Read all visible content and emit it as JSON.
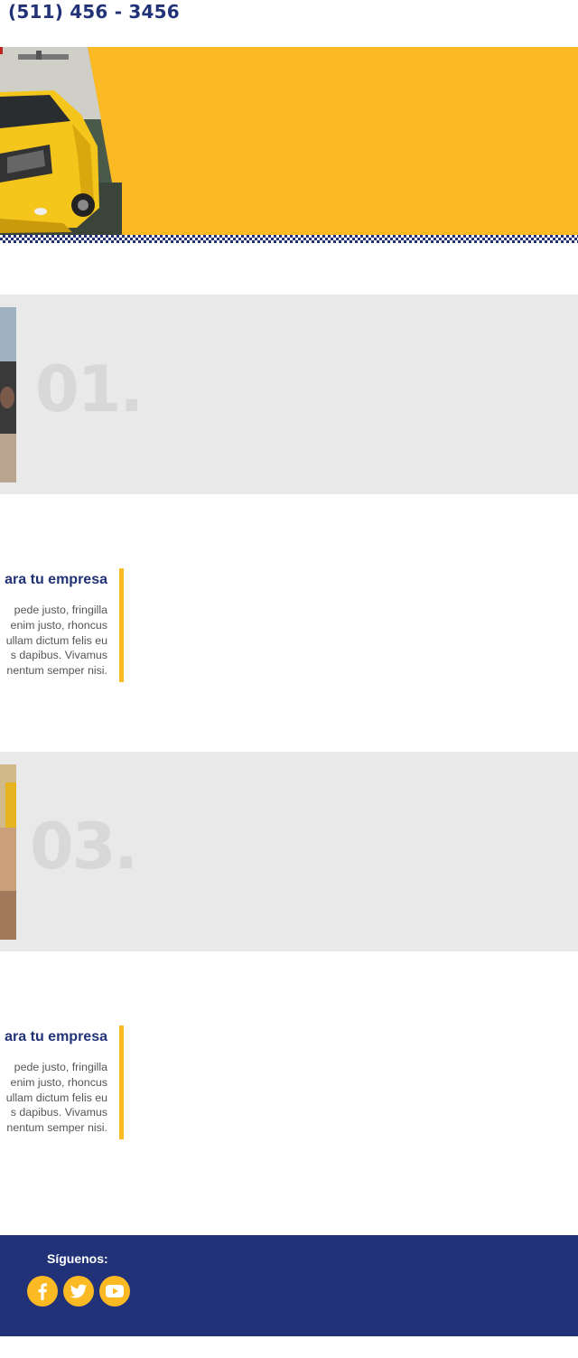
{
  "header": {
    "phone": "(511) 456 - 3456"
  },
  "steps": [
    {
      "number": "01."
    },
    {
      "number": "03."
    }
  ],
  "features": [
    {
      "title": "ara tu empresa",
      "lines": [
        " pede justo, fringilla",
        "enim justo, rhoncus",
        "ullam dictum felis eu",
        "s dapibus. Vivamus",
        "nentum semper nisi."
      ]
    },
    {
      "title": "ara tu empresa",
      "lines": [
        " pede justo, fringilla",
        "enim justo, rhoncus",
        "ullam dictum felis eu",
        "s dapibus. Vivamus",
        "nentum semper nisi."
      ]
    }
  ],
  "footer": {
    "follow_label": "Síguenos:",
    "social_icons": [
      "facebook-icon",
      "twitter-icon",
      "youtube-icon"
    ]
  },
  "colors": {
    "brand_yellow": "#FBB923",
    "brand_navy": "#223276",
    "step_bg": "#E9E9E9",
    "step_number": "#D8D8D8"
  }
}
